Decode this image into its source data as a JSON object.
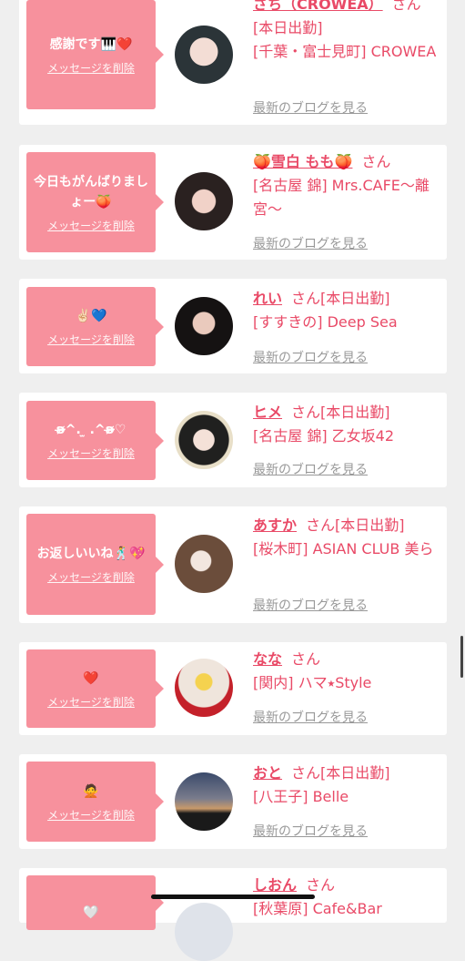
{
  "delete_label": "メッセージを削除",
  "blog_label": "最新のブログを見る",
  "honorific": "さん",
  "cards": [
    {
      "message": "感謝です🎹❤️",
      "name": "さち（CROWEA）",
      "attend": "",
      "shop": "[本日出勤]\n[千葉・富士見町] CROWEA"
    },
    {
      "message": "今日もがんばりましょー🍑",
      "name": "🍑雪白 もも🍑",
      "attend": "",
      "shop": "[名古屋 錦] Mrs.CAFE〜離宮〜"
    },
    {
      "message": "✌🏻💙",
      "name": "れい",
      "attend": "[本日出勤]",
      "shop": "[すすきの] Deep Sea"
    },
    {
      "message": "ʚ̴̶̷^. ̫ .^ʚ̴̶̷♡",
      "name": "ヒメ",
      "attend": "[本日出勤]",
      "shop": "[名古屋 錦] 乙女坂42"
    },
    {
      "message": "お返しいいね🕺💖",
      "name": "あすか",
      "attend": "[本日出勤]",
      "shop": "[桜木町] ASIAN CLUB 美ら"
    },
    {
      "message": "❤️",
      "name": "なな",
      "attend": "",
      "shop": "[関内] ハマ⭑Style"
    },
    {
      "message": "🙅",
      "name": "おと",
      "attend": "[本日出勤]",
      "shop": "[八王子] Belle"
    },
    {
      "message": "🤍",
      "name": "しおん",
      "attend": "",
      "shop": "[秋葉原] Cafe&Bar"
    }
  ],
  "colors": {
    "accent": "#e94a67",
    "bubble": "#f7919d",
    "background": "#efefef"
  }
}
